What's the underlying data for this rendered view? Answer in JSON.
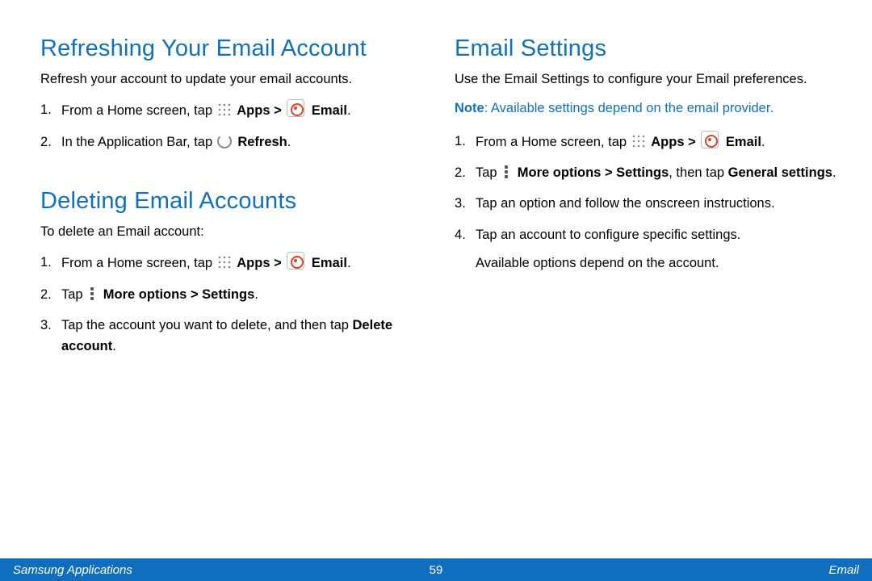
{
  "left": {
    "section1": {
      "heading": "Refreshing Your Email Account",
      "intro": "Refresh your account to update your email accounts.",
      "steps": [
        {
          "pre": "From a Home screen, tap ",
          "apps": "Apps > ",
          "email": "Email",
          "post": "."
        },
        {
          "pre": "In the Application Bar, tap ",
          "refresh": "Refresh",
          "post": "."
        }
      ]
    },
    "section2": {
      "heading": "Deleting Email Accounts",
      "intro": "To delete an Email account:",
      "steps": [
        {
          "pre": "From a Home screen, tap ",
          "apps": "Apps > ",
          "email": "Email",
          "post": "."
        },
        {
          "pre": "Tap ",
          "more": "More options > Settings",
          "post": "."
        },
        {
          "pre": "Tap the account you want to delete, and then tap ",
          "del": "Delete account",
          "post": "."
        }
      ]
    }
  },
  "right": {
    "heading": "Email Settings",
    "intro": "Use the Email Settings to configure your Email preferences.",
    "note_label": "Note",
    "note_text": ": Available settings depend on the email provider.",
    "steps": [
      {
        "pre": "From a Home screen, tap ",
        "apps": "Apps > ",
        "email": "Email",
        "post": "."
      },
      {
        "pre": "Tap ",
        "more": "More options > Settings",
        "mid": ", then tap ",
        "gen": "General settings",
        "post": "."
      },
      {
        "pre": "Tap an option and follow the onscreen instructions."
      },
      {
        "pre": "Tap an account to configure specific settings.",
        "sub": "Available options depend on the account."
      }
    ]
  },
  "footer": {
    "left": "Samsung Applications",
    "page": "59",
    "right": "Email"
  }
}
